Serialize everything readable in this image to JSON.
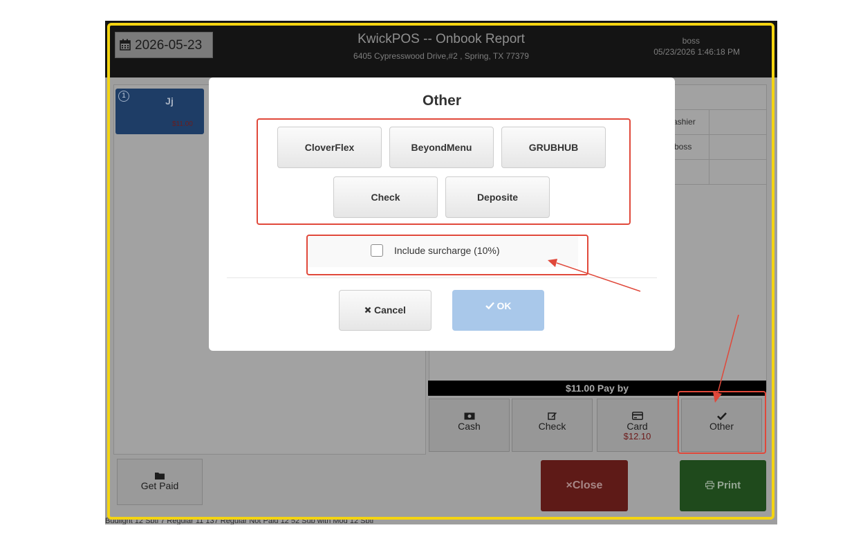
{
  "app": {
    "date": "2026-05-23",
    "title": "KwickPOS -- Onbook Report",
    "address": "6405 Cypresswood Drive,#2 , Spring, TX 77379",
    "user": "boss",
    "datetime": "05/23/2026 1:46:18 PM"
  },
  "order_card": {
    "number": "1",
    "name": "Jj",
    "amount": "$11.00"
  },
  "table_rows": [
    {
      "value": "ashier"
    },
    {
      "value": "boss"
    },
    {
      "value": ""
    }
  ],
  "pay_bar": "$11.00 Pay by",
  "pay_buttons": {
    "cash": "Cash",
    "check": "Check",
    "card": "Card",
    "card_amount": "$12.10",
    "other": "Other"
  },
  "actions": {
    "get_paid": "Get Paid",
    "close": "×Close",
    "print": "Print"
  },
  "bottom_strip": "Budlight 12 Sbtl          7 Regular 11          137 Regular Not Paid  12        52 Sub with Mod 12 Sbtl",
  "modal": {
    "title": "Other",
    "options": [
      "CloverFlex",
      "BeyondMenu",
      "GRUBHUB",
      "Check",
      "Deposite"
    ],
    "surcharge_label": "Include surcharge (10%)",
    "surcharge_checked": false,
    "cancel": "Cancel",
    "ok": "OK"
  },
  "colors": {
    "highlight_yellow": "#f4d411",
    "annotation_red": "#e0483a",
    "ok_blue": "#a9c8ea",
    "close_red": "#5e1a17",
    "print_green": "#1f4a1c"
  }
}
